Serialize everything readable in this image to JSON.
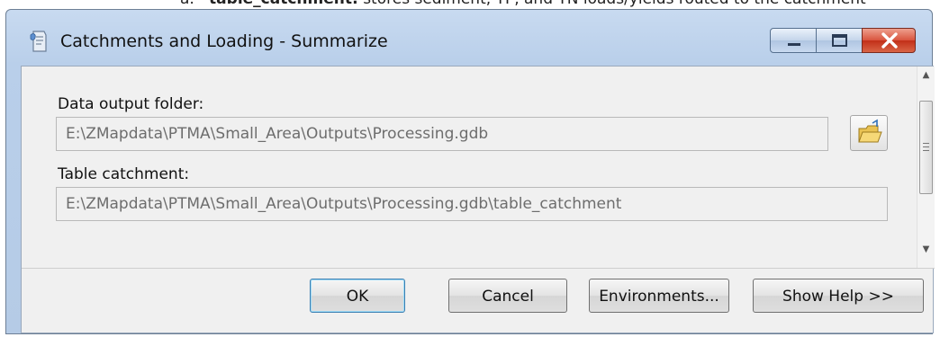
{
  "document": {
    "prefix": "a.",
    "bold_term": "table_catchment:",
    "rest": " stores sediment, TP, and TN loads/yields routed to the catchment"
  },
  "window": {
    "title": "Catchments and Loading - Summarize",
    "app_icon": "toolbox-script-icon",
    "controls": [
      "minimize-icon",
      "maximize-icon",
      "close-icon"
    ]
  },
  "form": {
    "data_output_folder": {
      "label": "Data output folder:",
      "value": "E:\\ZMapdata\\PTMA\\Small_Area\\Outputs\\Processing.gdb",
      "browse_icon": "open-folder-icon"
    },
    "table_catchment": {
      "label": "Table catchment:",
      "value": "E:\\ZMapdata\\PTMA\\Small_Area\\Outputs\\Processing.gdb\\table_catchment"
    }
  },
  "buttons": {
    "ok": "OK",
    "cancel": "Cancel",
    "environments": "Environments...",
    "show_help": "Show Help >>"
  }
}
